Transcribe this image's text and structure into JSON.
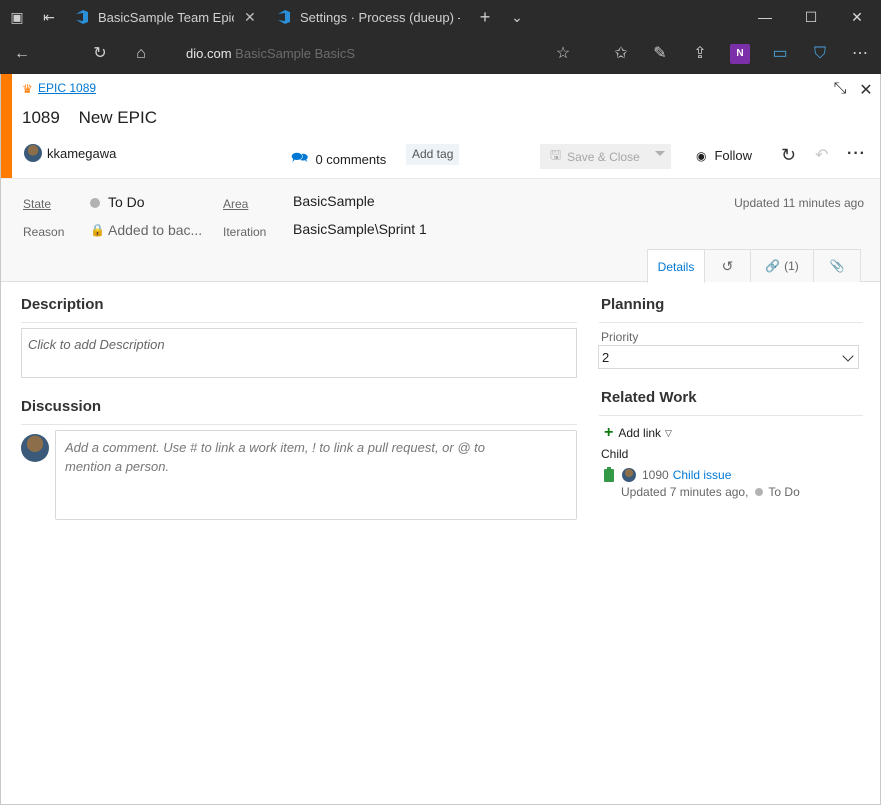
{
  "browser": {
    "tabs": [
      {
        "title": "BasicSample Team Epics"
      },
      {
        "title": "Settings · Process (dueup) -"
      }
    ],
    "url": {
      "host": "dio.com",
      "path_dim": "BasicSample BasicS"
    }
  },
  "work_item": {
    "type_link": "EPIC 1089",
    "id": "1089",
    "title": "New EPIC",
    "assigned_to": "kkamegawa",
    "comments_label": "0 comments",
    "add_tag_label": "Add tag",
    "save_close_label": "Save & Close",
    "follow_label": "Follow"
  },
  "fields": {
    "state_label": "State",
    "state_value": "To Do",
    "reason_label": "Reason",
    "reason_value": "Added to bac...",
    "area_label": "Area",
    "area_value": "BasicSample",
    "iteration_label": "Iteration",
    "iteration_value": "BasicSample\\Sprint 1",
    "updated": "Updated 11 minutes ago"
  },
  "tabs": {
    "details": "Details",
    "links": "(1)"
  },
  "description": {
    "heading": "Description",
    "placeholder": "Click to add Description"
  },
  "discussion": {
    "heading": "Discussion",
    "placeholder_line1": "Add a comment. Use # to link a work item, ! to link a pull request, or @ to",
    "placeholder_line2": "mention a person."
  },
  "planning": {
    "heading": "Planning",
    "priority_label": "Priority",
    "priority_value": "2"
  },
  "related_work": {
    "heading": "Related Work",
    "add_link_label": "Add link",
    "child_label": "Child",
    "child_id": "1090",
    "child_title": "Child issue",
    "child_updated": "Updated 7 minutes ago,",
    "child_state": "To Do"
  },
  "colors": {
    "accent": "#ff7b00",
    "link": "#0078d4",
    "add_green": "#107c10"
  }
}
